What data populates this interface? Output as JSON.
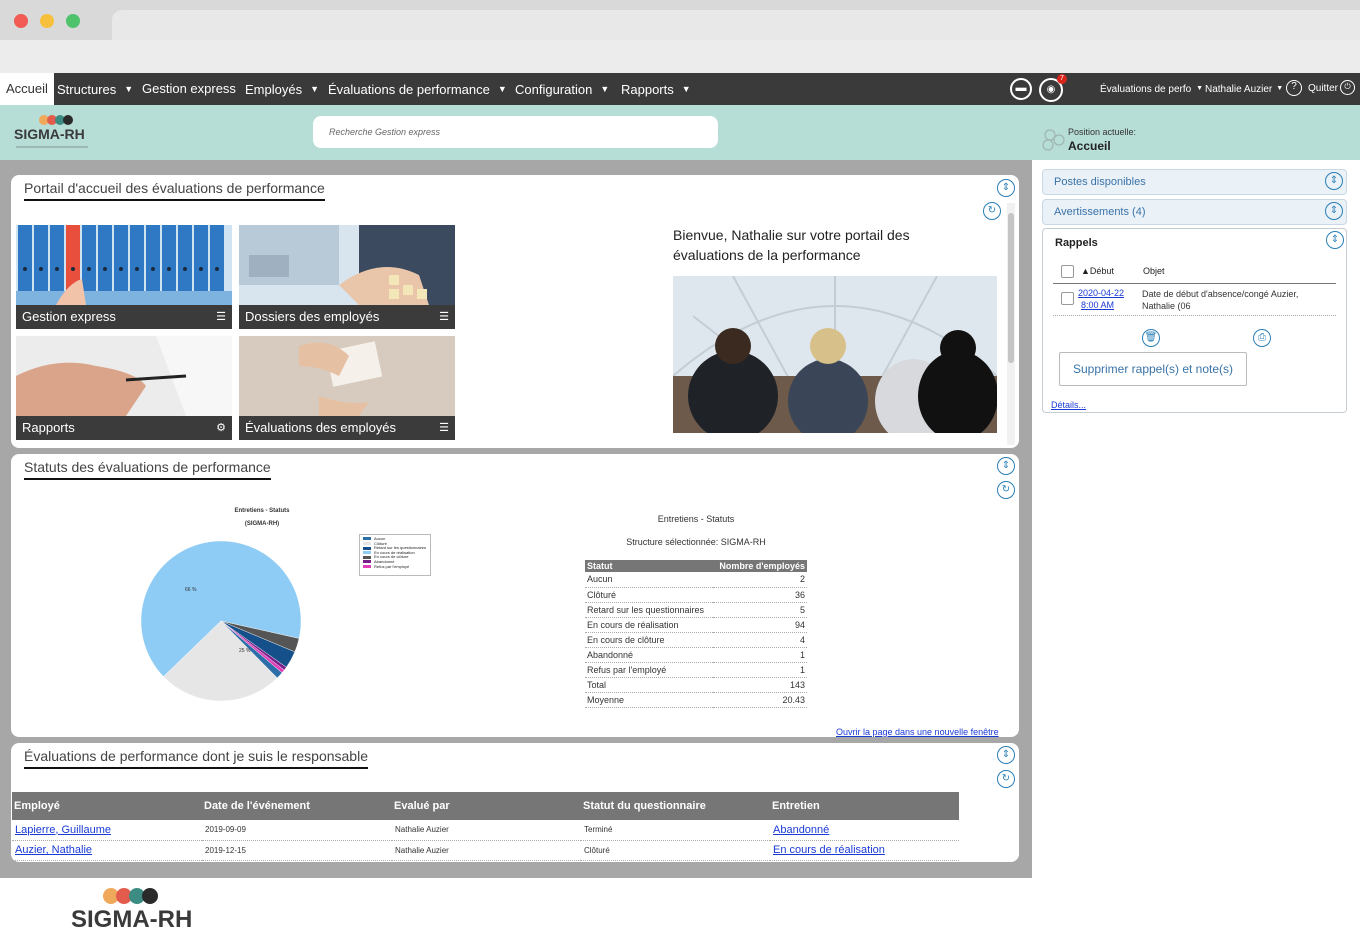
{
  "colors": {
    "nav_bg": "#3a3a3a",
    "header_band": "#b7ddd7",
    "accent_blue": "#2a7fb8",
    "table_header": "#767676",
    "link": "#1a3ad6"
  },
  "topnav": {
    "items": [
      "Accueil",
      "Structures",
      "Gestion express",
      "Employés",
      "Évaluations de performance",
      "Configuration",
      "Rapports"
    ],
    "chat_icon": "chat-icon",
    "notification_count": "7",
    "context_menu": "Évaluations de perfo",
    "user_menu": "Nathalie Auzier",
    "help_symbol": "?",
    "quit": "Quitter"
  },
  "header": {
    "logo_text": "SIGMA-RH",
    "search_placeholder": "Recherche Gestion express",
    "position_label": "Position actuelle:",
    "position_value": "Accueil"
  },
  "portal": {
    "title": "Portail d'accueil des évaluations de performance",
    "tiles": [
      "Gestion express",
      "Dossiers des employés",
      "Rapports",
      "Évaluations des employés"
    ],
    "welcome_text": "Bienvue,  Nathalie sur votre portail des évaluations de la performance"
  },
  "statuses": {
    "title": "Statuts des évaluations de performance",
    "chart_title": "Entretiens - Statuts",
    "chart_subtitle": "(SIGMA-RH)",
    "table_title": "Entretiens - Statuts",
    "structure_label": "Structure sélectionnée: SIGMA-RH",
    "table_headers": [
      "Statut",
      "Nombre d'employés"
    ],
    "table_rows": [
      [
        "Aucun",
        "2"
      ],
      [
        "Clôturé",
        "36"
      ],
      [
        "Retard sur les questionnaires",
        "5"
      ],
      [
        "En cours de réalisation",
        "94"
      ],
      [
        "En cours de clôture",
        "4"
      ],
      [
        "Abandonné",
        "1"
      ],
      [
        "Refus par l'employé",
        "1"
      ],
      [
        "Total",
        "143"
      ],
      [
        "Moyenne",
        "20.43"
      ]
    ],
    "open_link": "Ouvrir la page dans une nouvelle fenêtre"
  },
  "chart_data": {
    "type": "pie",
    "title": "Entretiens - Statuts",
    "subtitle": "(SIGMA-RH)",
    "labels": [
      "Aucun",
      "Clôturé",
      "Retard sur les questionnaires",
      "En cours de réalisation",
      "En cours de clôture",
      "Abandonné",
      "Refus par l'employé"
    ],
    "values": [
      2,
      36,
      5,
      94,
      4,
      1,
      1
    ],
    "colors": [
      "#2b6ea8",
      "#e6e6e6",
      "#15508a",
      "#8ecbf5",
      "#555555",
      "#7a1f8a",
      "#e040b8"
    ],
    "slice_labels": [
      "66 %",
      "25 %"
    ],
    "legend_position": "right"
  },
  "responsible": {
    "title": "Évaluations de performance dont je suis le responsable",
    "headers": [
      "Employé",
      "Date de l'événement",
      "Evalué par",
      "Statut du questionnaire",
      "Entretien"
    ],
    "rows": [
      [
        "Lapierre, Guillaume",
        "2019-09-09",
        "Nathalie Auzier",
        "Terminé",
        "Abandonné"
      ],
      [
        "Auzier, Nathalie",
        "2019-12-15",
        "Nathalie Auzier",
        "Clôturé",
        "En cours de réalisation"
      ]
    ]
  },
  "sidebar": {
    "postes": "Postes disponibles",
    "avertissements": "Avertissements (4)",
    "rappels": {
      "title": "Rappels",
      "col_debut": "Début",
      "col_objet": "Objet",
      "row_date": "2020-04-22",
      "row_time": "8:00 AM",
      "row_object": "Date de début d'absence/congé Auzier, Nathalie (06",
      "delete_button": "Supprimer rappel(s) et note(s)",
      "details_link": "Détails..."
    }
  },
  "footer": {
    "logo_text": "SIGMA-RH"
  }
}
